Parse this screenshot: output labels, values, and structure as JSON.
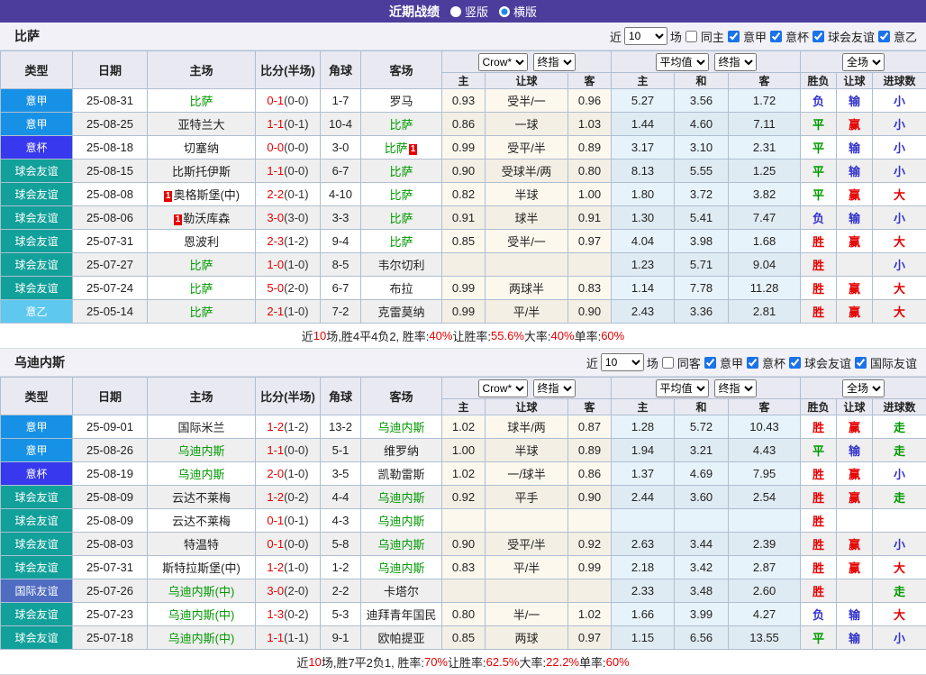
{
  "topbar": {
    "title": "近期战绩",
    "radios": [
      {
        "label": "竖版",
        "selected": false
      },
      {
        "label": "横版",
        "selected": true
      }
    ]
  },
  "table_header": {
    "main_cols": [
      "类型",
      "日期",
      "主场",
      "比分(半场)",
      "角球",
      "客场"
    ],
    "selects": {
      "bookmaker": "Crow*",
      "odds_stage": "终指",
      "avg": "平均值",
      "avg_stage": "终指",
      "scope": "全场"
    },
    "sub_cols": [
      "主",
      "让球",
      "客",
      "主",
      "和",
      "客",
      "胜负",
      "让球",
      "进球数"
    ]
  },
  "type_colors": {
    "意甲": "#1791e6",
    "意杯": "#3838ee",
    "球会友谊": "#12a09a",
    "意乙": "#5fc8ef",
    "国际友谊": "#4f6cc0"
  },
  "result_colors": {
    "胜": "red",
    "赢": "red",
    "大": "red",
    "平": "green",
    "走": "green",
    "负": "blue",
    "输": "blue",
    "小": "blue"
  },
  "sections": [
    {
      "team": "比萨",
      "filter": {
        "near": "近",
        "games": "10",
        "unit": "场",
        "same": "同主",
        "leagues": [
          "意甲",
          "意杯",
          "球会友谊",
          "意乙"
        ]
      },
      "rows": [
        {
          "type": "意甲",
          "date": "25-08-31",
          "home": "比萨",
          "home_hl": true,
          "score": "0-1",
          "half": "(0-0)",
          "corner": "1-7",
          "away": "罗马",
          "o1": "0.93",
          "line": "受半/一",
          "o2": "0.96",
          "a1": "5.27",
          "a2": "3.56",
          "a3": "1.72",
          "r1": "负",
          "r2": "输",
          "r3": "小"
        },
        {
          "type": "意甲",
          "date": "25-08-25",
          "home": "亚特兰大",
          "score": "1-1",
          "half": "(0-1)",
          "corner": "10-4",
          "away": "比萨",
          "away_hl": true,
          "o1": "0.86",
          "line": "一球",
          "o2": "1.03",
          "a1": "1.44",
          "a2": "4.60",
          "a3": "7.11",
          "r1": "平",
          "r2": "赢",
          "r3": "小"
        },
        {
          "type": "意杯",
          "date": "25-08-18",
          "home": "切塞纳",
          "score": "0-0",
          "half": "(0-0)",
          "corner": "3-0",
          "away": "比萨",
          "away_hl": true,
          "away_card": "1",
          "o1": "0.99",
          "line": "受平/半",
          "o2": "0.89",
          "a1": "3.17",
          "a2": "3.10",
          "a3": "2.31",
          "r1": "平",
          "r2": "输",
          "r3": "小"
        },
        {
          "type": "球会友谊",
          "date": "25-08-15",
          "home": "比斯托伊斯",
          "score": "1-1",
          "half": "(0-0)",
          "corner": "6-7",
          "away": "比萨",
          "away_hl": true,
          "o1": "0.90",
          "line": "受球半/两",
          "o2": "0.80",
          "a1": "8.13",
          "a2": "5.55",
          "a3": "1.25",
          "r1": "平",
          "r2": "输",
          "r3": "小"
        },
        {
          "type": "球会友谊",
          "date": "25-08-08",
          "home": "奥格斯堡(中)",
          "home_card": "1",
          "score": "2-2",
          "half": "(0-1)",
          "corner": "4-10",
          "away": "比萨",
          "away_hl": true,
          "o1": "0.82",
          "line": "半球",
          "o2": "1.00",
          "a1": "1.80",
          "a2": "3.72",
          "a3": "3.82",
          "r1": "平",
          "r2": "赢",
          "r3": "大"
        },
        {
          "type": "球会友谊",
          "date": "25-08-06",
          "home": "勒沃库森",
          "home_card": "1",
          "score": "3-0",
          "half": "(3-0)",
          "corner": "3-3",
          "away": "比萨",
          "away_hl": true,
          "o1": "0.91",
          "line": "球半",
          "o2": "0.91",
          "a1": "1.30",
          "a2": "5.41",
          "a3": "7.47",
          "r1": "负",
          "r2": "输",
          "r3": "小"
        },
        {
          "type": "球会友谊",
          "date": "25-07-31",
          "home": "恩波利",
          "score": "2-3",
          "half": "(1-2)",
          "corner": "9-4",
          "away": "比萨",
          "away_hl": true,
          "o1": "0.85",
          "line": "受半/一",
          "o2": "0.97",
          "a1": "4.04",
          "a2": "3.98",
          "a3": "1.68",
          "r1": "胜",
          "r2": "赢",
          "r3": "大"
        },
        {
          "type": "球会友谊",
          "date": "25-07-27",
          "home": "比萨",
          "home_hl": true,
          "score": "1-0",
          "half": "(1-0)",
          "corner": "8-5",
          "away": "韦尔切利",
          "a1": "1.23",
          "a2": "5.71",
          "a3": "9.04",
          "r1": "胜",
          "r3": "小"
        },
        {
          "type": "球会友谊",
          "date": "25-07-24",
          "home": "比萨",
          "home_hl": true,
          "score": "5-0",
          "half": "(2-0)",
          "corner": "6-7",
          "away": "布拉",
          "o1": "0.99",
          "line": "两球半",
          "o2": "0.83",
          "a1": "1.14",
          "a2": "7.78",
          "a3": "11.28",
          "r1": "胜",
          "r2": "赢",
          "r3": "大"
        },
        {
          "type": "意乙",
          "date": "25-05-14",
          "home": "比萨",
          "home_hl": true,
          "score": "2-1",
          "half": "(1-0)",
          "corner": "7-2",
          "away": "克雷莫纳",
          "o1": "0.99",
          "line": "平/半",
          "o2": "0.90",
          "a1": "2.43",
          "a2": "3.36",
          "a3": "2.81",
          "r1": "胜",
          "r2": "赢",
          "r3": "大"
        }
      ],
      "summary": [
        {
          "t": "近"
        },
        {
          "t": "10",
          "red": true
        },
        {
          "t": "场,胜4平4负2, 胜率:"
        },
        {
          "t": "40%",
          "red": true
        },
        {
          "t": " 让胜率:"
        },
        {
          "t": "55.6%",
          "red": true
        },
        {
          "t": " 大率:"
        },
        {
          "t": "40%",
          "red": true
        },
        {
          "t": " 单率:"
        },
        {
          "t": "60%",
          "red": true
        }
      ]
    },
    {
      "team": "乌迪内斯",
      "filter": {
        "near": "近",
        "games": "10",
        "unit": "场",
        "same": "同客",
        "leagues": [
          "意甲",
          "意杯",
          "球会友谊",
          "国际友谊"
        ]
      },
      "rows": [
        {
          "type": "意甲",
          "date": "25-09-01",
          "home": "国际米兰",
          "score": "1-2",
          "half": "(1-2)",
          "corner": "13-2",
          "away": "乌迪内斯",
          "away_hl": true,
          "o1": "1.02",
          "line": "球半/两",
          "o2": "0.87",
          "a1": "1.28",
          "a2": "5.72",
          "a3": "10.43",
          "r1": "胜",
          "r2": "赢",
          "r3": "走"
        },
        {
          "type": "意甲",
          "date": "25-08-26",
          "home": "乌迪内斯",
          "home_hl": true,
          "score": "1-1",
          "half": "(0-0)",
          "corner": "5-1",
          "away": "维罗纳",
          "o1": "1.00",
          "line": "半球",
          "o2": "0.89",
          "a1": "1.94",
          "a2": "3.21",
          "a3": "4.43",
          "r1": "平",
          "r2": "输",
          "r3": "走"
        },
        {
          "type": "意杯",
          "date": "25-08-19",
          "home": "乌迪内斯",
          "home_hl": true,
          "score": "2-0",
          "half": "(1-0)",
          "corner": "3-5",
          "away": "凯勒雷斯",
          "o1": "1.02",
          "line": "一/球半",
          "o2": "0.86",
          "a1": "1.37",
          "a2": "4.69",
          "a3": "7.95",
          "r1": "胜",
          "r2": "赢",
          "r3": "小"
        },
        {
          "type": "球会友谊",
          "date": "25-08-09",
          "home": "云达不莱梅",
          "score": "1-2",
          "half": "(0-2)",
          "corner": "4-4",
          "away": "乌迪内斯",
          "away_hl": true,
          "o1": "0.92",
          "line": "平手",
          "o2": "0.90",
          "a1": "2.44",
          "a2": "3.60",
          "a3": "2.54",
          "r1": "胜",
          "r2": "赢",
          "r3": "走"
        },
        {
          "type": "球会友谊",
          "date": "25-08-09",
          "home": "云达不莱梅",
          "score": "0-1",
          "half": "(0-1)",
          "corner": "4-3",
          "away": "乌迪内斯",
          "away_hl": true,
          "r1": "胜"
        },
        {
          "type": "球会友谊",
          "date": "25-08-03",
          "home": "特温特",
          "score": "0-1",
          "half": "(0-0)",
          "corner": "5-8",
          "away": "乌迪内斯",
          "away_hl": true,
          "o1": "0.90",
          "line": "受平/半",
          "o2": "0.92",
          "a1": "2.63",
          "a2": "3.44",
          "a3": "2.39",
          "r1": "胜",
          "r2": "赢",
          "r3": "小"
        },
        {
          "type": "球会友谊",
          "date": "25-07-31",
          "home": "斯特拉斯堡(中)",
          "score": "1-2",
          "half": "(1-0)",
          "corner": "1-2",
          "away": "乌迪内斯",
          "away_hl": true,
          "o1": "0.83",
          "line": "平/半",
          "o2": "0.99",
          "a1": "2.18",
          "a2": "3.42",
          "a3": "2.87",
          "r1": "胜",
          "r2": "赢",
          "r3": "大"
        },
        {
          "type": "国际友谊",
          "date": "25-07-26",
          "home": "乌迪内斯(中)",
          "home_hl": true,
          "score": "3-0",
          "half": "(2-0)",
          "corner": "2-2",
          "away": "卡塔尔",
          "a1": "2.33",
          "a2": "3.48",
          "a3": "2.60",
          "r1": "胜",
          "r3": "走"
        },
        {
          "type": "球会友谊",
          "date": "25-07-23",
          "home": "乌迪内斯(中)",
          "home_hl": true,
          "score": "1-3",
          "half": "(0-2)",
          "corner": "5-3",
          "away": "迪拜青年国民",
          "o1": "0.80",
          "line": "半/一",
          "o2": "1.02",
          "a1": "1.66",
          "a2": "3.99",
          "a3": "4.27",
          "r1": "负",
          "r2": "输",
          "r3": "大"
        },
        {
          "type": "球会友谊",
          "date": "25-07-18",
          "home": "乌迪内斯(中)",
          "home_hl": true,
          "score": "1-1",
          "half": "(1-1)",
          "corner": "9-1",
          "away": "欧帕提亚",
          "o1": "0.85",
          "line": "两球",
          "o2": "0.97",
          "a1": "1.15",
          "a2": "6.56",
          "a3": "13.55",
          "r1": "平",
          "r2": "输",
          "r3": "小"
        }
      ],
      "summary": [
        {
          "t": "近"
        },
        {
          "t": "10",
          "red": true
        },
        {
          "t": "场,胜7平2负1, 胜率:"
        },
        {
          "t": "70%",
          "red": true
        },
        {
          "t": " 让胜率:"
        },
        {
          "t": "62.5%",
          "red": true
        },
        {
          "t": " 大率:"
        },
        {
          "t": "22.2%",
          "red": true
        },
        {
          "t": " 单率:"
        },
        {
          "t": "60%",
          "red": true
        }
      ]
    }
  ]
}
